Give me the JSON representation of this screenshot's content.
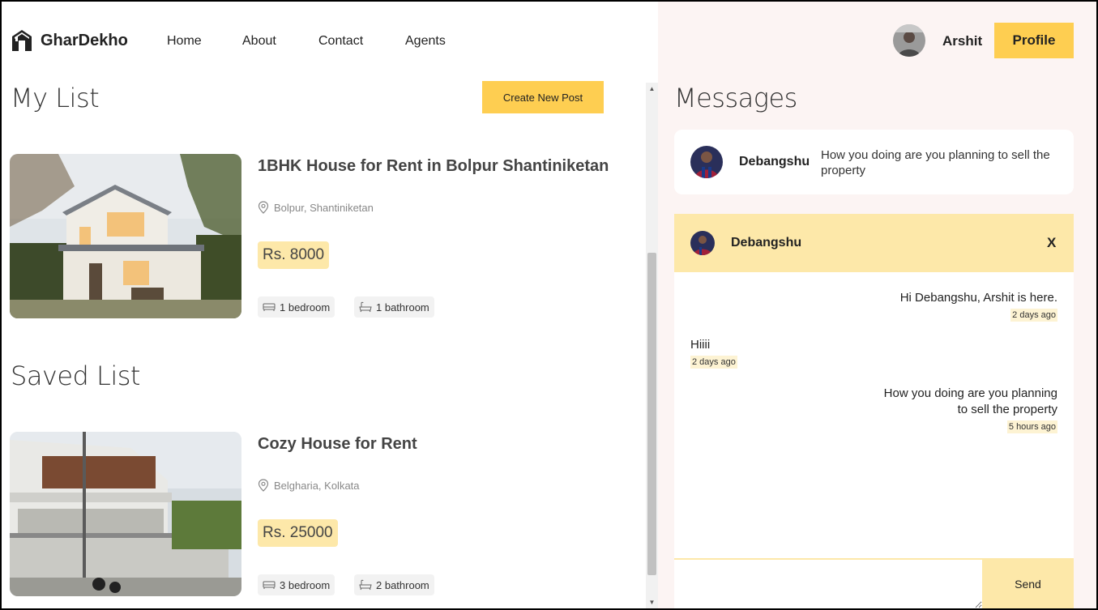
{
  "navbar": {
    "brand": "GharDekho",
    "links": [
      "Home",
      "About",
      "Contact",
      "Agents"
    ],
    "user_name": "Arshit",
    "profile_label": "Profile"
  },
  "my_list": {
    "title": "My List",
    "create_label": "Create New Post",
    "cards": [
      {
        "title": "1BHK House for Rent in Bolpur Shantiniketan",
        "address": "Bolpur, Shantiniketan",
        "price": "Rs. 8000",
        "bedrooms": "1 bedroom",
        "bathrooms": "1 bathroom"
      }
    ]
  },
  "saved_list": {
    "title": "Saved List",
    "cards": [
      {
        "title": "Cozy House for Rent",
        "address": "Belgharia, Kolkata",
        "price": "Rs. 25000",
        "bedrooms": "3 bedroom",
        "bathrooms": "2 bathroom"
      }
    ]
  },
  "messages": {
    "title": "Messages",
    "preview": {
      "name": "Debangshu",
      "text": "How you doing are you planning to sell the property"
    },
    "chat": {
      "name": "Debangshu",
      "close_label": "X",
      "items": [
        {
          "text": "Hi Debangshu, Arshit is here.",
          "time": "2 days ago",
          "own": true
        },
        {
          "text": "Hiiii",
          "time": "2 days ago",
          "own": false
        },
        {
          "text_line1": "How you doing are you planning",
          "text_line2": "to sell the property",
          "time": "5 hours ago",
          "own": true
        }
      ],
      "send_label": "Send"
    }
  },
  "colors": {
    "accent": "#fece51",
    "accent_light": "#fde8a9",
    "right_bg": "#fcf4f3"
  }
}
